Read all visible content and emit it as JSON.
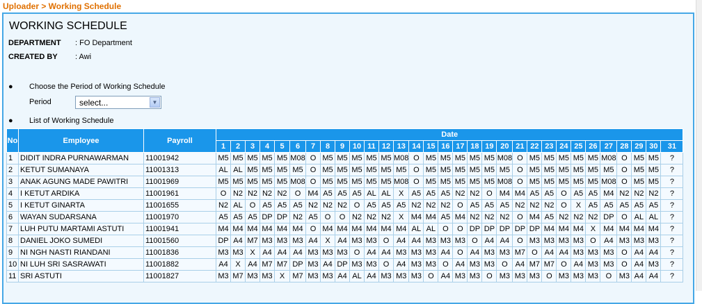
{
  "breadcrumb": "Uploader > Working Schedule",
  "title": "WORKING SCHEDULE",
  "meta": {
    "department_label": "DEPARTMENT",
    "department_value": ": FO Department",
    "created_by_label": "CREATED BY",
    "created_by_value": ": Awi"
  },
  "period_section": {
    "bullet_text": "Choose the Period of Working Schedule",
    "period_label": "Period",
    "selected": "select..."
  },
  "list_section": {
    "bullet_text": "List of Working Schedule"
  },
  "table": {
    "headers": {
      "no": "No",
      "employee": "Employee",
      "payroll": "Payroll",
      "date": "Date"
    },
    "days": [
      "1",
      "2",
      "3",
      "4",
      "5",
      "6",
      "7",
      "8",
      "9",
      "10",
      "11",
      "12",
      "13",
      "14",
      "15",
      "16",
      "17",
      "18",
      "19",
      "20",
      "21",
      "22",
      "23",
      "24",
      "25",
      "26",
      "27",
      "28",
      "29",
      "30",
      "31"
    ],
    "rows": [
      {
        "no": "1",
        "employee": "DIDIT INDRA PURNAWARMAN",
        "payroll": "11001942",
        "shifts": [
          "M5",
          "M5",
          "M5",
          "M5",
          "M5",
          "M08",
          "O",
          "M5",
          "M5",
          "M5",
          "M5",
          "M5",
          "M08",
          "O",
          "M5",
          "M5",
          "M5",
          "M5",
          "M5",
          "M08",
          "O",
          "M5",
          "M5",
          "M5",
          "M5",
          "M5",
          "M08",
          "O",
          "M5",
          "M5",
          "?"
        ]
      },
      {
        "no": "2",
        "employee": "KETUT SUMANAYA",
        "payroll": "11001313",
        "shifts": [
          "AL",
          "AL",
          "M5",
          "M5",
          "M5",
          "M5",
          "O",
          "M5",
          "M5",
          "M5",
          "M5",
          "M5",
          "M5",
          "O",
          "M5",
          "M5",
          "M5",
          "M5",
          "M5",
          "M5",
          "O",
          "M5",
          "M5",
          "M5",
          "M5",
          "M5",
          "M5",
          "O",
          "M5",
          "M5",
          "?"
        ]
      },
      {
        "no": "3",
        "employee": "ANAK AGUNG MADE PAWITRI",
        "payroll": "11001969",
        "shifts": [
          "M5",
          "M5",
          "M5",
          "M5",
          "M5",
          "M08",
          "O",
          "M5",
          "M5",
          "M5",
          "M5",
          "M5",
          "M08",
          "O",
          "M5",
          "M5",
          "M5",
          "M5",
          "M5",
          "M08",
          "O",
          "M5",
          "M5",
          "M5",
          "M5",
          "M5",
          "M08",
          "O",
          "M5",
          "M5",
          "?"
        ]
      },
      {
        "no": "4",
        "employee": "I KETUT ARDIKA",
        "payroll": "11001961",
        "shifts": [
          "O",
          "N2",
          "N2",
          "N2",
          "N2",
          "O",
          "M4",
          "A5",
          "A5",
          "A5",
          "AL",
          "AL",
          "X",
          "A5",
          "A5",
          "A5",
          "N2",
          "N2",
          "O",
          "M4",
          "M4",
          "A5",
          "A5",
          "O",
          "A5",
          "A5",
          "M4",
          "N2",
          "N2",
          "N2",
          "?"
        ]
      },
      {
        "no": "5",
        "employee": "I KETUT GINARTA",
        "payroll": "11001655",
        "shifts": [
          "N2",
          "AL",
          "O",
          "A5",
          "A5",
          "A5",
          "N2",
          "N2",
          "N2",
          "O",
          "A5",
          "A5",
          "A5",
          "N2",
          "N2",
          "N2",
          "O",
          "A5",
          "A5",
          "A5",
          "N2",
          "N2",
          "N2",
          "O",
          "X",
          "A5",
          "A5",
          "A5",
          "A5",
          "A5",
          "?"
        ]
      },
      {
        "no": "6",
        "employee": "WAYAN SUDARSANA",
        "payroll": "11001970",
        "shifts": [
          "A5",
          "A5",
          "A5",
          "DP",
          "DP",
          "N2",
          "A5",
          "O",
          "O",
          "N2",
          "N2",
          "N2",
          "X",
          "M4",
          "M4",
          "A5",
          "M4",
          "N2",
          "N2",
          "N2",
          "O",
          "M4",
          "A5",
          "N2",
          "N2",
          "N2",
          "DP",
          "O",
          "AL",
          "AL",
          "?"
        ]
      },
      {
        "no": "7",
        "employee": "LUH PUTU MARTAMI ASTUTI",
        "payroll": "11001941",
        "shifts": [
          "M4",
          "M4",
          "M4",
          "M4",
          "M4",
          "M4",
          "O",
          "M4",
          "M4",
          "M4",
          "M4",
          "M4",
          "M4",
          "AL",
          "AL",
          "O",
          "O",
          "DP",
          "DP",
          "DP",
          "DP",
          "DP",
          "M4",
          "M4",
          "M4",
          "X",
          "M4",
          "M4",
          "M4",
          "M4",
          "?"
        ]
      },
      {
        "no": "8",
        "employee": "DANIEL JOKO SUMEDI",
        "payroll": "11001560",
        "shifts": [
          "DP",
          "A4",
          "M7",
          "M3",
          "M3",
          "M3",
          "A4",
          "X",
          "A4",
          "M3",
          "M3",
          "O",
          "A4",
          "A4",
          "M3",
          "M3",
          "M3",
          "O",
          "A4",
          "A4",
          "O",
          "M3",
          "M3",
          "M3",
          "M3",
          "O",
          "A4",
          "M3",
          "M3",
          "M3",
          "?"
        ]
      },
      {
        "no": "9",
        "employee": "NI NGH NASTI RIANDANI",
        "payroll": "11001836",
        "shifts": [
          "M3",
          "M3",
          "X",
          "A4",
          "A4",
          "A4",
          "M3",
          "M3",
          "M3",
          "O",
          "A4",
          "A4",
          "M3",
          "M3",
          "M3",
          "A4",
          "O",
          "A4",
          "M3",
          "M3",
          "M7",
          "O",
          "A4",
          "A4",
          "M3",
          "M3",
          "M3",
          "O",
          "A4",
          "A4",
          "?"
        ]
      },
      {
        "no": "10",
        "employee": "NI LUH SRI SASRAWATI",
        "payroll": "11001882",
        "shifts": [
          "A4",
          "X",
          "A4",
          "M7",
          "M7",
          "DP",
          "M3",
          "A4",
          "DP",
          "M3",
          "M3",
          "O",
          "A4",
          "M3",
          "M3",
          "O",
          "A4",
          "M3",
          "M3",
          "O",
          "A4",
          "M7",
          "M7",
          "O",
          "A4",
          "M3",
          "M3",
          "O",
          "A4",
          "M3",
          "?"
        ]
      },
      {
        "no": "11",
        "employee": "SRI ASTUTI",
        "payroll": "11001827",
        "shifts": [
          "M3",
          "M7",
          "M3",
          "M3",
          "X",
          "M7",
          "M3",
          "M3",
          "A4",
          "AL",
          "A4",
          "M3",
          "M3",
          "M3",
          "O",
          "A4",
          "M3",
          "M3",
          "O",
          "M3",
          "M3",
          "M3",
          "O",
          "M3",
          "M3",
          "M3",
          "O",
          "M3",
          "A4",
          "A4",
          "?"
        ]
      }
    ]
  },
  "colors": {
    "breadcrumb": "#e07000",
    "panel_border": "#45a7e6",
    "panel_bg": "#eef7fd",
    "header_bg": "#1a96ea"
  }
}
